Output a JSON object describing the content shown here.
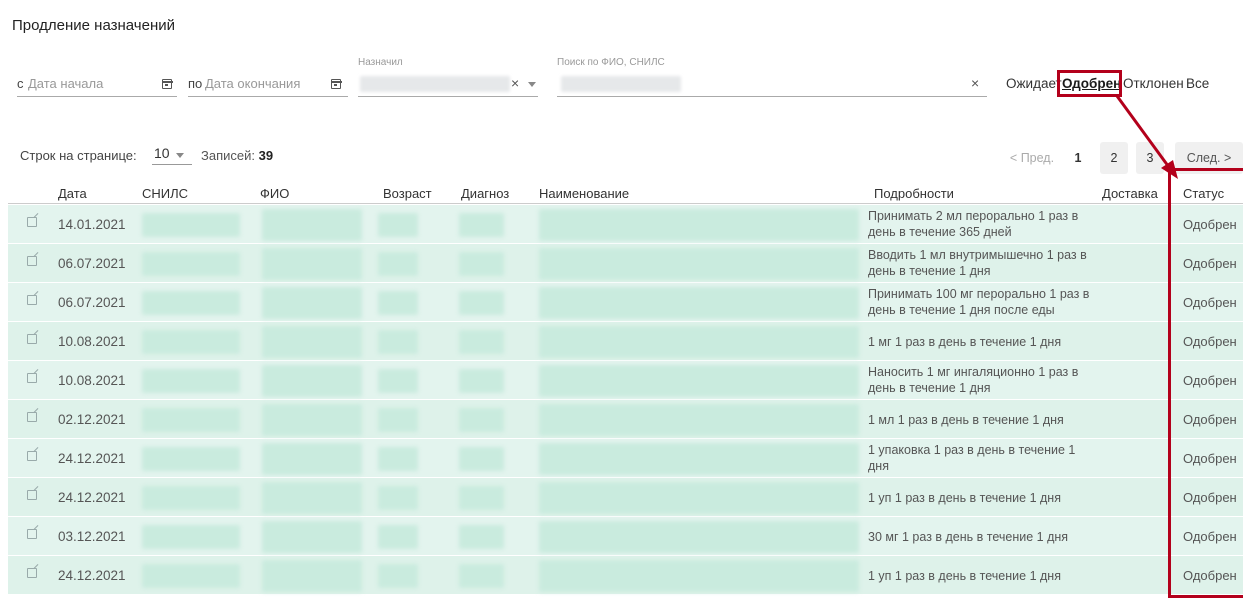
{
  "page": {
    "title": "Продление назначений"
  },
  "filters": {
    "date_from_prefix": "с",
    "date_from_placeholder": "Дата начала",
    "date_to_prefix": "по",
    "date_to_placeholder": "Дата окончания",
    "prescriber_label": "Назначил",
    "search_label": "Поиск по ФИО, СНИЛС",
    "clear_symbol": "×",
    "calendar_icon": "calendar-icon"
  },
  "status_tabs": [
    {
      "label": "Ожидает",
      "active": false
    },
    {
      "label": "Одобрен",
      "active": true
    },
    {
      "label": "Отклонен",
      "active": false
    },
    {
      "label": "Все",
      "active": false
    }
  ],
  "pagination": {
    "rows_per_page_label": "Строк на странице:",
    "rows_per_page_value": "10",
    "records_label": "Записей:",
    "records_count": "39",
    "prev_label": "< Пред.",
    "pages": [
      "1",
      "2",
      "3"
    ],
    "next_label": "След. >"
  },
  "table": {
    "columns": [
      "Дата",
      "СНИЛС",
      "ФИО",
      "Возраст",
      "Диагноз",
      "Наименование",
      "Подробности",
      "Доставка",
      "Статус"
    ],
    "rows": [
      {
        "date": "14.01.2021",
        "details": "Принимать 2 мл перорально 1 раз в день в течение 365 дней",
        "status": "Одобрен"
      },
      {
        "date": "06.07.2021",
        "details": "Вводить 1 мл внутримышечно 1 раз в день в течение 1 дня",
        "status": "Одобрен"
      },
      {
        "date": "06.07.2021",
        "details": "Принимать 100 мг перорально 1 раз в день в течение 1 дня после еды",
        "status": "Одобрен"
      },
      {
        "date": "10.08.2021",
        "details": "1 мг 1 раз в день в течение 1 дня",
        "status": "Одобрен"
      },
      {
        "date": "10.08.2021",
        "details": "Наносить 1 мг ингаляционно 1 раз в день в течение 1 дня",
        "status": "Одобрен"
      },
      {
        "date": "02.12.2021",
        "details": "1 мл 1 раз в день в течение 1 дня",
        "status": "Одобрен"
      },
      {
        "date": "24.12.2021",
        "details": "1 упаковка 1 раз в день в течение 1 дня",
        "status": "Одобрен"
      },
      {
        "date": "24.12.2021",
        "details": "1 уп 1 раз в день в течение 1 дня",
        "status": "Одобрен"
      },
      {
        "date": "03.12.2021",
        "details": "30 мг 1 раз в день в течение 1 дня",
        "status": "Одобрен"
      },
      {
        "date": "24.12.2021",
        "details": "1 уп 1 раз в день в течение 1 дня",
        "status": "Одобрен"
      }
    ]
  },
  "annotation": {
    "highlight_color": "#b3001b"
  }
}
